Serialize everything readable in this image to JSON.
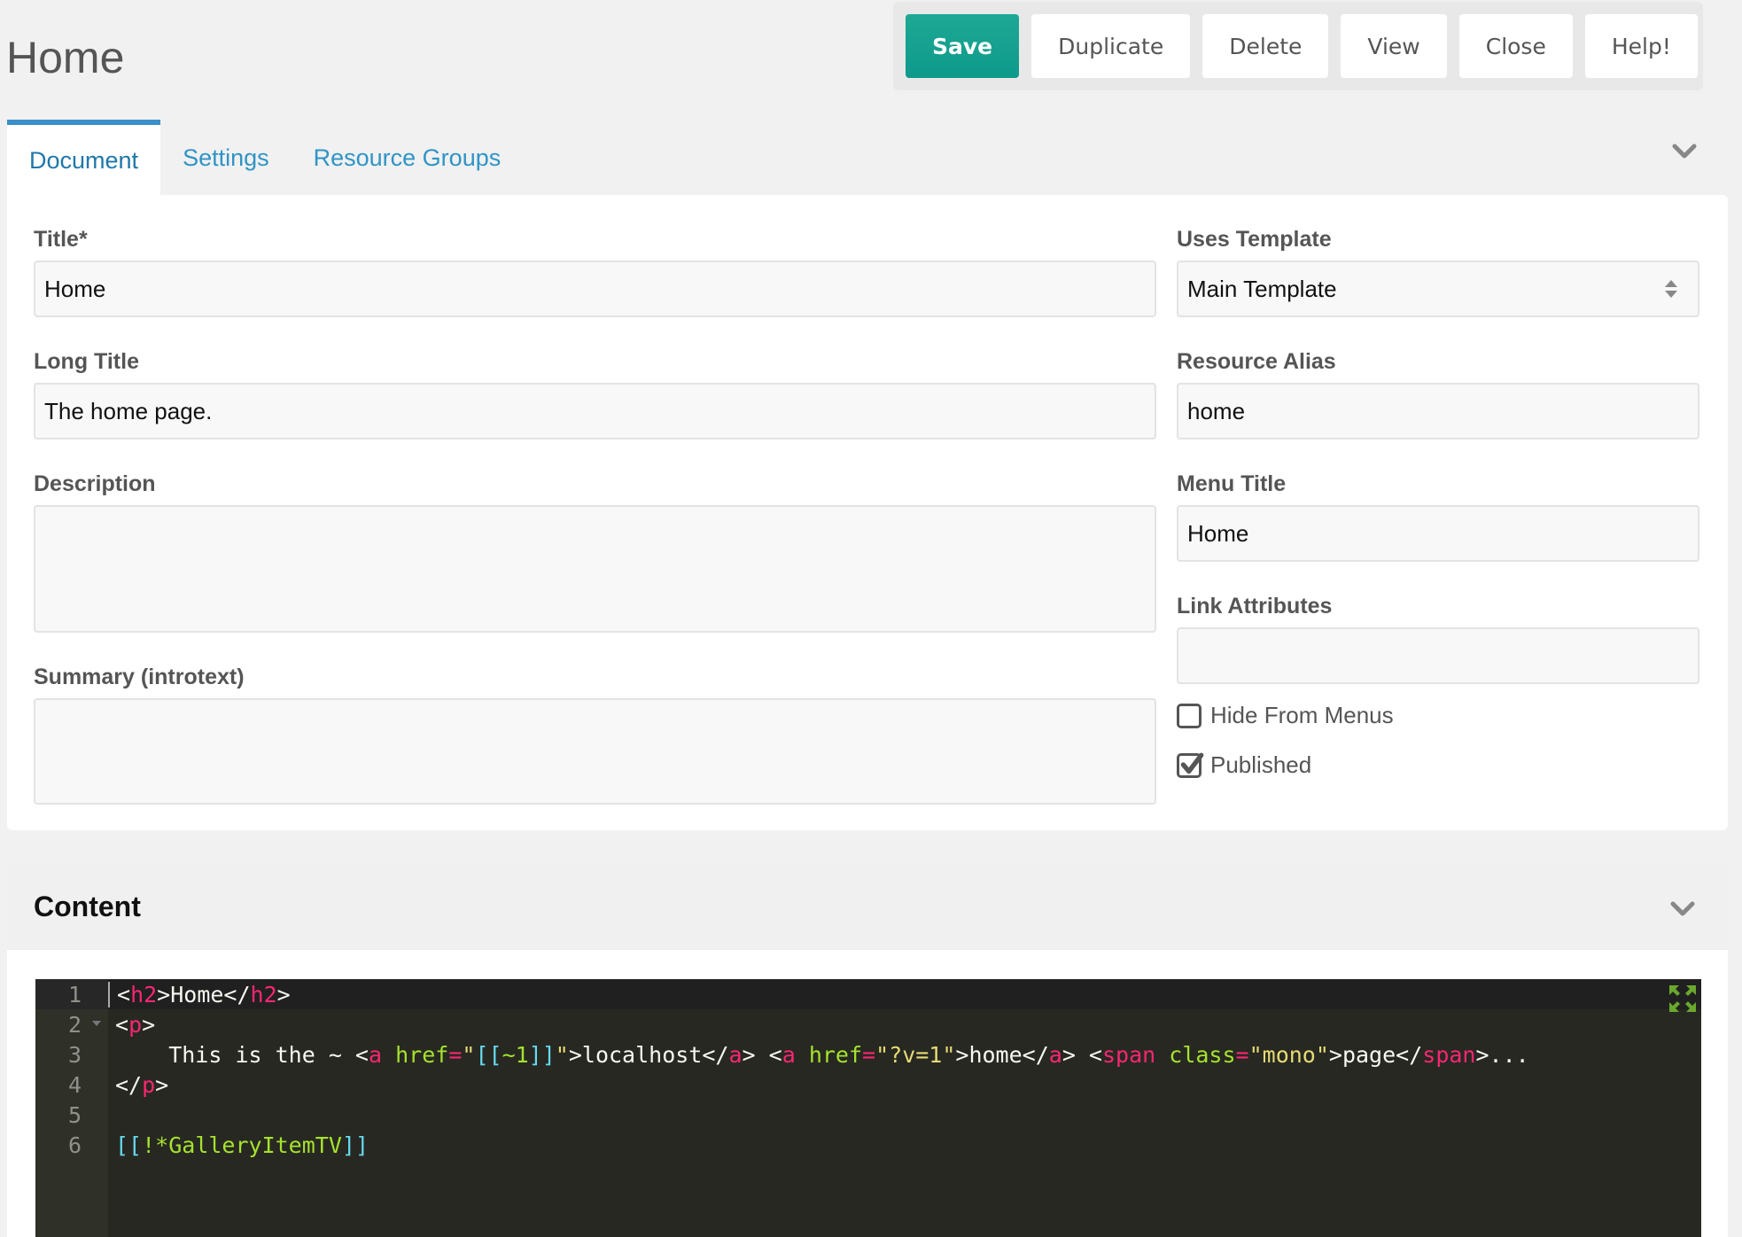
{
  "page": {
    "title": "Home"
  },
  "toolbar": {
    "save_label": "Save",
    "duplicate_label": "Duplicate",
    "delete_label": "Delete",
    "view_label": "View",
    "close_label": "Close",
    "help_label": "Help!"
  },
  "tabs": [
    {
      "label": "Document",
      "active": true
    },
    {
      "label": "Settings",
      "active": false
    },
    {
      "label": "Resource Groups",
      "active": false
    }
  ],
  "form": {
    "title": {
      "label": "Title*",
      "value": "Home"
    },
    "long_title": {
      "label": "Long Title",
      "value": "The home page."
    },
    "description": {
      "label": "Description",
      "value": ""
    },
    "summary": {
      "label": "Summary (introtext)",
      "value": ""
    },
    "template": {
      "label": "Uses Template",
      "value": "Main Template"
    },
    "alias": {
      "label": "Resource Alias",
      "value": "home"
    },
    "menu_title": {
      "label": "Menu Title",
      "value": "Home"
    },
    "link_attributes": {
      "label": "Link Attributes",
      "value": ""
    },
    "hide_from_menus": {
      "label": "Hide From Menus",
      "checked": false
    },
    "published": {
      "label": "Published",
      "checked": true
    }
  },
  "content": {
    "title": "Content",
    "line_numbers": [
      "1",
      "2",
      "3",
      "4",
      "5",
      "6"
    ],
    "lines": [
      "<h2>Home</h2>",
      "<p>",
      "    This is the ~ <a href=\"[[~1]]\">localhost</a> <a href=\"?v=1\">home</a> <span class=\"mono\">page</span>...",
      "</p>",
      "",
      "[[!*GalleryItemTV]]"
    ]
  },
  "colors": {
    "primary_button": "#13a08f",
    "tab_accent": "#3a90c9",
    "link_text": "#2f94c6",
    "editor_bg": "#272822",
    "editor_tag": "#f92672",
    "editor_attr": "#a6e22e",
    "editor_string": "#e6db74",
    "editor_modx_tag": "#66d9ef"
  }
}
